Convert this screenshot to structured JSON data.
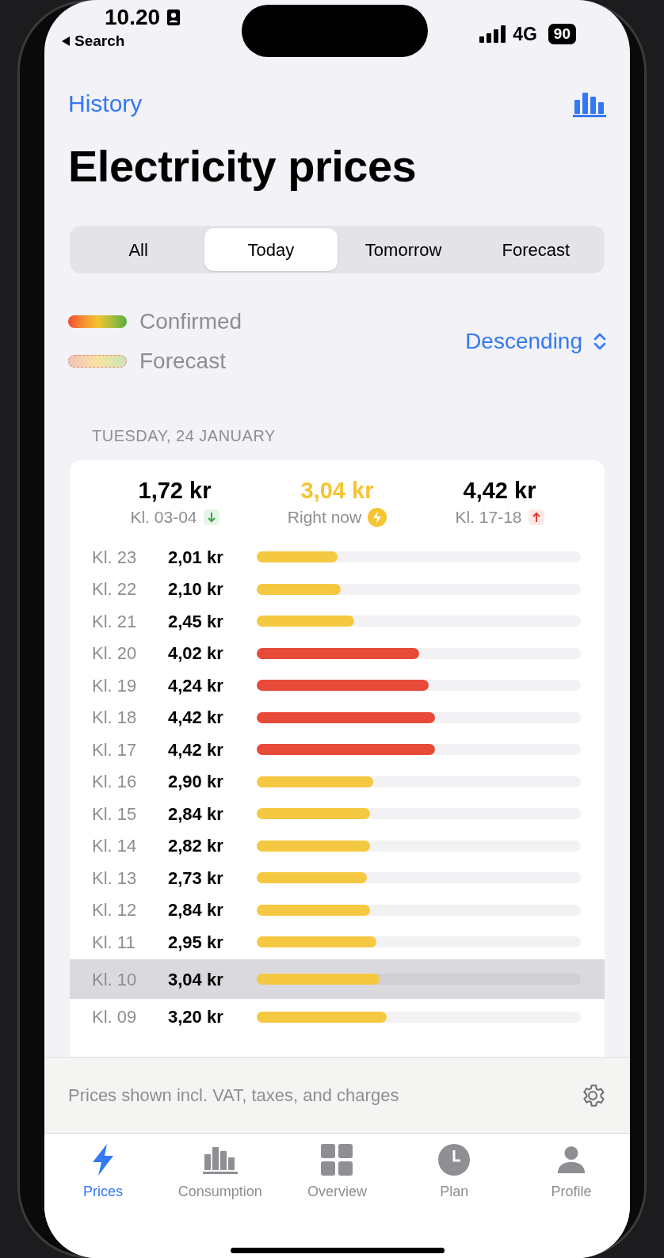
{
  "status_bar": {
    "time": "10.20",
    "back": "Search",
    "network": "4G",
    "battery": "90"
  },
  "nav": {
    "back": "History"
  },
  "title": "Electricity prices",
  "tabs": [
    {
      "label": "All",
      "selected": false
    },
    {
      "label": "Today",
      "selected": true
    },
    {
      "label": "Tomorrow",
      "selected": false
    },
    {
      "label": "Forecast",
      "selected": false
    }
  ],
  "legend": [
    {
      "kind": "confirmed",
      "label": "Confirmed"
    },
    {
      "kind": "forecast",
      "label": "Forecast"
    }
  ],
  "sort": {
    "label": "Descending"
  },
  "date": "TUESDAY, 24 JANUARY",
  "summary": [
    {
      "kind": "low",
      "value": "1,72 kr",
      "label": "Kl. 03-04"
    },
    {
      "kind": "now",
      "value": "3,04 kr",
      "label": "Right now"
    },
    {
      "kind": "high",
      "value": "4,42 kr",
      "label": "Kl. 17-18"
    }
  ],
  "rows": [
    {
      "hour": "Kl. 23",
      "price": "2,01 kr",
      "level": 0.25,
      "color": "#f5c842",
      "selected": false
    },
    {
      "hour": "Kl. 22",
      "price": "2,10 kr",
      "level": 0.26,
      "color": "#f5c842",
      "selected": false
    },
    {
      "hour": "Kl. 21",
      "price": "2,45 kr",
      "level": 0.3,
      "color": "#f5c842",
      "selected": false
    },
    {
      "hour": "Kl. 20",
      "price": "4,02 kr",
      "level": 0.5,
      "color": "#e84a3a",
      "selected": false
    },
    {
      "hour": "Kl. 19",
      "price": "4,24 kr",
      "level": 0.53,
      "color": "#e84a3a",
      "selected": false
    },
    {
      "hour": "Kl. 18",
      "price": "4,42 kr",
      "level": 0.55,
      "color": "#e84a3a",
      "selected": false
    },
    {
      "hour": "Kl. 17",
      "price": "4,42 kr",
      "level": 0.55,
      "color": "#e84a3a",
      "selected": false
    },
    {
      "hour": "Kl. 16",
      "price": "2,90 kr",
      "level": 0.36,
      "color": "#f5c842",
      "selected": false
    },
    {
      "hour": "Kl. 15",
      "price": "2,84 kr",
      "level": 0.35,
      "color": "#f5c842",
      "selected": false
    },
    {
      "hour": "Kl. 14",
      "price": "2,82 kr",
      "level": 0.35,
      "color": "#f5c842",
      "selected": false
    },
    {
      "hour": "Kl. 13",
      "price": "2,73 kr",
      "level": 0.34,
      "color": "#f5c842",
      "selected": false
    },
    {
      "hour": "Kl. 12",
      "price": "2,84 kr",
      "level": 0.35,
      "color": "#f5c842",
      "selected": false
    },
    {
      "hour": "Kl. 11",
      "price": "2,95 kr",
      "level": 0.37,
      "color": "#f5c842",
      "selected": false
    },
    {
      "hour": "Kl. 10",
      "price": "3,04 kr",
      "level": 0.38,
      "color": "#f5c842",
      "selected": true
    },
    {
      "hour": "Kl. 09",
      "price": "3,20 kr",
      "level": 0.4,
      "color": "#f5c842",
      "selected": false
    }
  ],
  "footer": {
    "note": "Prices shown incl. VAT, taxes, and charges"
  },
  "tab_bar": [
    {
      "kind": "prices",
      "label": "Prices",
      "selected": true
    },
    {
      "kind": "consumption",
      "label": "Consumption",
      "selected": false
    },
    {
      "kind": "overview",
      "label": "Overview",
      "selected": false
    },
    {
      "kind": "plan",
      "label": "Plan",
      "selected": false
    },
    {
      "kind": "profile",
      "label": "Profile",
      "selected": false
    }
  ]
}
